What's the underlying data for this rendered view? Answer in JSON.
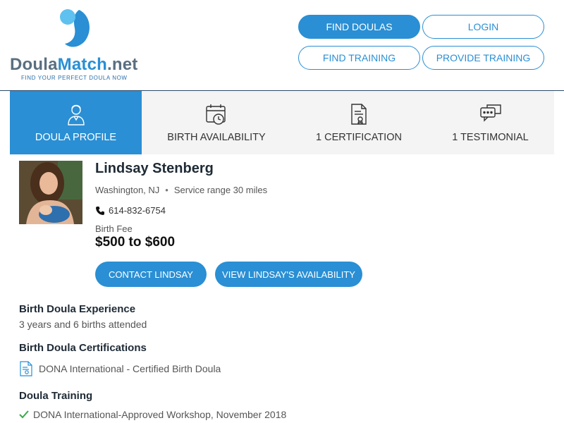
{
  "logo": {
    "part1": "Doula",
    "part2": "Match",
    "part3": ".net",
    "tagline": "FIND YOUR PERFECT DOULA NOW"
  },
  "nav": {
    "find_doulas": "FIND DOULAS",
    "login": "LOGIN",
    "find_training": "FIND TRAINING",
    "provide_training": "PROVIDE TRAINING"
  },
  "tabs": [
    {
      "label": "DOULA PROFILE",
      "icon": "person-icon"
    },
    {
      "label": "BIRTH AVAILABILITY",
      "icon": "calendar-clock-icon"
    },
    {
      "label": "1 CERTIFICATION",
      "icon": "certificate-icon"
    },
    {
      "label": "1 TESTIMONIAL",
      "icon": "chat-bubbles-icon"
    }
  ],
  "profile": {
    "name": "Lindsay Stenberg",
    "location": "Washington, NJ",
    "service_range": "Service range 30 miles",
    "phone": "614-832-6754",
    "fee_label": "Birth Fee",
    "fee_value": "$500 to $600",
    "contact_button": "CONTACT LINDSAY",
    "availability_button": "VIEW LINDSAY'S AVAILABILITY"
  },
  "experience": {
    "title": "Birth Doula Experience",
    "text": "3 years and 6 births attended"
  },
  "certifications": {
    "title": "Birth Doula Certifications",
    "items": [
      "DONA International - Certified Birth Doula"
    ]
  },
  "training": {
    "title": "Doula Training",
    "items": [
      "DONA International-Approved Workshop, November 2018"
    ]
  },
  "colors": {
    "brand_blue": "#2a8fd4",
    "tab_bg": "#f4f4f4",
    "logo_gray": "#5a6f80"
  }
}
